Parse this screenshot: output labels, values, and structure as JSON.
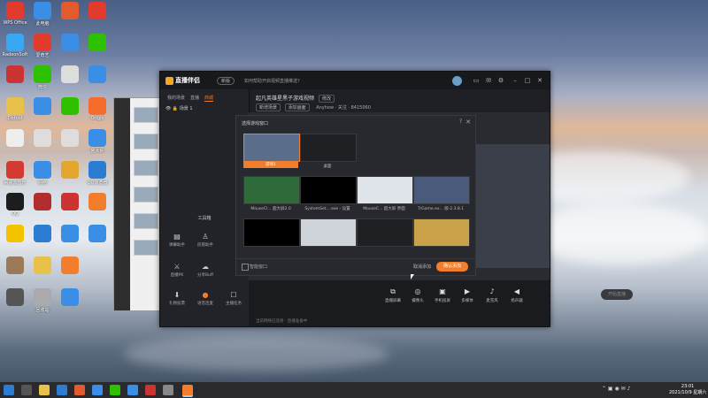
{
  "desktop": {
    "icons": [
      {
        "label": "WPS Office",
        "icon": "wps-icon",
        "color": "#e23b2e"
      },
      {
        "label": "RadeonSoft",
        "icon": "radeon-icon",
        "color": "#3aa7f2"
      },
      {
        "label": "",
        "icon": "game-icon",
        "color": "#cc3333"
      },
      {
        "label": "Dbtool",
        "icon": "folder-icon",
        "color": "#e8c14a"
      },
      {
        "label": "",
        "icon": "doc-icon",
        "color": "#eeeeee"
      },
      {
        "label": "网易云音乐",
        "icon": "netease-music-icon",
        "color": "#d33a31"
      },
      {
        "label": "QQ",
        "icon": "qq-icon",
        "color": "#1d1d1d"
      },
      {
        "label": "",
        "icon": "g-app-icon",
        "color": "#f3c300"
      },
      {
        "label": "",
        "icon": "app-icon",
        "color": "#9b7a5a"
      },
      {
        "label": "",
        "icon": "phone-icon",
        "color": "#555555"
      },
      {
        "label": "此电脑",
        "icon": "computer-icon",
        "color": "#3a8ee6"
      },
      {
        "label": "爱奇艺",
        "icon": "iqiyi-icon",
        "color": "#e23b2e"
      },
      {
        "label": "微信",
        "icon": "wechat-icon",
        "color": "#2dc100"
      },
      {
        "label": "",
        "icon": "screen-icon",
        "color": "#3a8ee6"
      },
      {
        "label": "",
        "icon": "file-icon",
        "color": "#dddddd"
      },
      {
        "label": "网络",
        "icon": "network-icon",
        "color": "#3a8ee6"
      },
      {
        "label": "",
        "icon": "archive-icon",
        "color": "#b22d2d"
      },
      {
        "label": "",
        "icon": "edge-icon",
        "color": "#2b7cd3"
      },
      {
        "label": "",
        "icon": "folder-icon",
        "color": "#e8c14a"
      },
      {
        "label": "回收站",
        "icon": "recycle-bin-icon",
        "color": "#aaaaaa"
      },
      {
        "label": "",
        "icon": "app-icon",
        "color": "#e25b2e"
      },
      {
        "label": "",
        "icon": "shield-icon",
        "color": "#3a8ee6"
      },
      {
        "label": "",
        "icon": "file-icon",
        "color": "#dddddd"
      },
      {
        "label": "",
        "icon": "add-icon",
        "color": "#2dc100"
      },
      {
        "label": "",
        "icon": "doc-icon",
        "color": "#dddddd"
      },
      {
        "label": "",
        "icon": "color-icon",
        "color": "#e2a52e"
      },
      {
        "label": "",
        "icon": "app-icon",
        "color": "#cc3333"
      },
      {
        "label": "",
        "icon": "app-icon",
        "color": "#3a8ee6"
      },
      {
        "label": "",
        "icon": "app-icon",
        "color": "#f27d2c"
      },
      {
        "label": "",
        "icon": "app-icon",
        "color": "#3a8ee6"
      },
      {
        "label": "",
        "icon": "app-icon",
        "color": "#e23b2e"
      },
      {
        "label": "",
        "icon": "app-icon",
        "color": "#2dc100"
      },
      {
        "label": "",
        "icon": "app-icon",
        "color": "#3a8ee6"
      },
      {
        "label": "Origin",
        "icon": "origin-icon",
        "color": "#f56c2d"
      },
      {
        "label": "鲁大师",
        "icon": "ludashi-icon",
        "color": "#3a8ee6"
      },
      {
        "label": "QQ浏览器",
        "icon": "qq-browser-icon",
        "color": "#2b7cd3"
      },
      {
        "label": "",
        "icon": "game-icon",
        "color": "#f27d2c"
      },
      {
        "label": "",
        "icon": "app-icon",
        "color": "#3a8ee6"
      }
    ]
  },
  "window": {
    "app_name": "直播伴侣",
    "badge": "新版",
    "notice": "如何帮助开启视频直播推送?",
    "tabs": [
      "我的场景",
      "直播",
      "商城"
    ],
    "scene_label": "场景 1",
    "toolbox_title": "工具箱",
    "tools": [
      {
        "label": "弹幕助手",
        "icon": "danmaku-icon"
      },
      {
        "label": "房管助手",
        "icon": "admin-icon"
      },
      {
        "label": "直播PK",
        "icon": "pk-icon"
      },
      {
        "label": "分享Buff",
        "icon": "share-icon"
      },
      {
        "label": "礼物投票",
        "icon": "gift-icon"
      },
      {
        "label": "语音连麦",
        "icon": "voice-icon"
      },
      {
        "label": "主播任务",
        "icon": "task-icon"
      }
    ],
    "stream_title": "起凡英雄星黑子游戏视频",
    "stream_title_tag": "修改",
    "info_pills": [
      "新增场景",
      "添加画面"
    ],
    "info_text": "Anyhow · 关注 · 8415060",
    "bottom_buttons": [
      {
        "label": "直播屏幕",
        "icon": "screen-share-icon"
      },
      {
        "label": "摄像头",
        "icon": "camera-icon"
      },
      {
        "label": "手机投屏",
        "icon": "mobile-cast-icon"
      },
      {
        "label": "多媒体",
        "icon": "media-icon"
      },
      {
        "label": "麦克风",
        "icon": "mic-icon"
      },
      {
        "label": "扬声器",
        "icon": "speaker-icon"
      }
    ],
    "start_live": "开始直播",
    "status_line": "当前网络已连接 · 直播准备中"
  },
  "dialog": {
    "title": "选择游戏窗口",
    "windows": [
      {
        "label": "游戏1",
        "selected": true
      },
      {
        "label": "桌面",
        "selected": false
      },
      {
        "label": "MouseCl... 超大屏2.0",
        "selected": false
      },
      {
        "label": "SystemSet....exe - 设置",
        "selected": false
      },
      {
        "label": "MouseC... 超大屏 界面",
        "selected": false
      },
      {
        "label": "7/Game.ex... 版-2.3.8.1",
        "selected": false
      },
      {
        "label": "",
        "selected": false
      },
      {
        "label": "",
        "selected": false
      },
      {
        "label": "",
        "selected": false
      },
      {
        "label": "",
        "selected": false
      }
    ],
    "checkbox_label": "智能窗口",
    "cancel": "取消添加",
    "confirm": "确认添加"
  },
  "taskbar": {
    "time": "23:01",
    "date": "2021/10/9 星期六"
  }
}
